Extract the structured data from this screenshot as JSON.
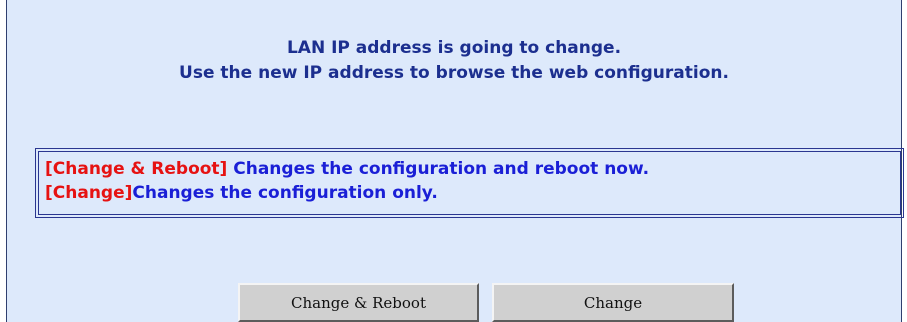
{
  "message": {
    "line1": "LAN IP address is going to change.",
    "line2": "Use the new IP address to browse the web configuration."
  },
  "notice": {
    "items": [
      {
        "tag": "[Change & Reboot]",
        "text": " Changes the configuration and reboot now."
      },
      {
        "tag": "[Change]",
        "text": "Changes the configuration only."
      }
    ]
  },
  "buttons": {
    "change_reboot_label": "Change & Reboot",
    "change_label": "Change"
  },
  "colors": {
    "panel_background": "#dde9fb",
    "message_text": "#1c2f8f",
    "notice_text": "#1a1fd6",
    "notice_tag": "#e61212",
    "button_face": "#d0d0d0"
  }
}
